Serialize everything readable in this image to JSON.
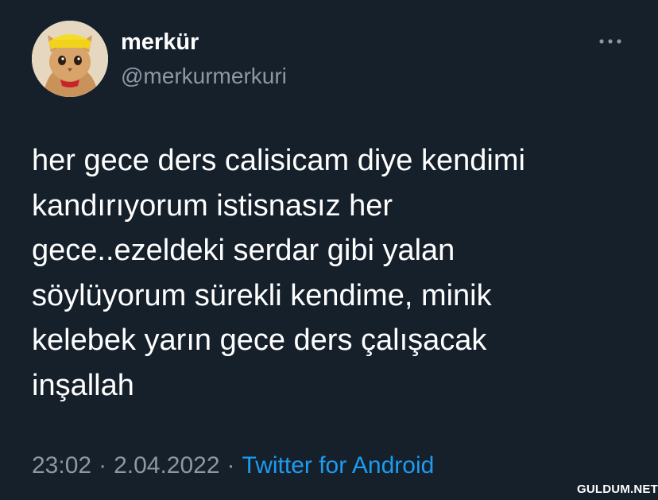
{
  "tweet": {
    "author": {
      "display_name": "merkür",
      "handle": "@merkurmerkuri",
      "avatar_icon": "kitten-avatar-icon"
    },
    "text_lines": [
      "her gece ders calisicam diye kendimi",
      "kandırıyorum istisnasız her",
      "gece..ezeldeki serdar gibi yalan",
      "söylüyorum sürekli kendime, minik",
      "kelebek yarın gece ders çalışacak",
      "inşallah"
    ],
    "time": "23:02",
    "separator": "·",
    "date": "2.04.2022",
    "source": "Twitter for Android",
    "more_icon": "more-options-icon"
  },
  "watermark": "GULDUM.NET",
  "colors": {
    "background": "#15202b",
    "text_primary": "#ffffff",
    "text_secondary": "#8b98a5",
    "link": "#1d9bf0"
  }
}
